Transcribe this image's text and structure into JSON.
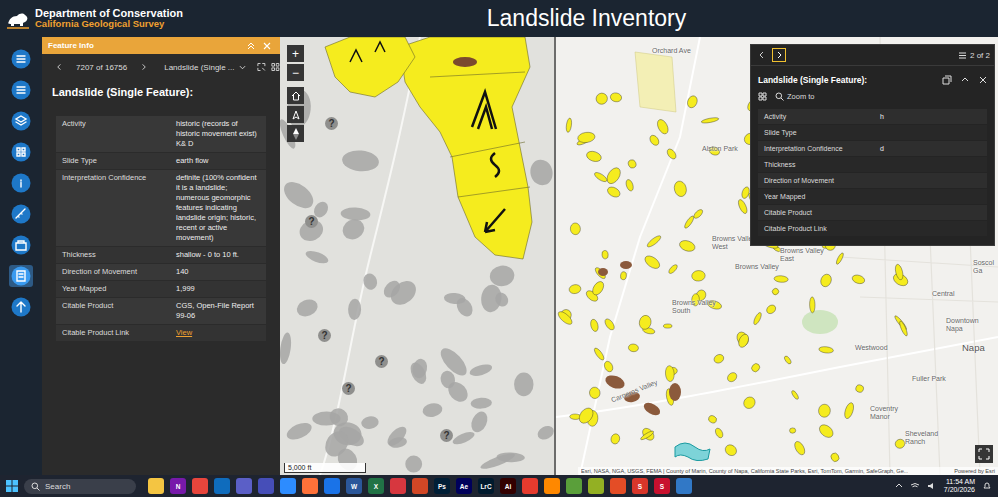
{
  "header": {
    "org": "Department of Conservation",
    "suborg": "California Geological Survey",
    "title": "Landslide Inventory"
  },
  "rail": {
    "items": [
      {
        "selected": false
      },
      {
        "selected": false
      },
      {
        "selected": false
      },
      {
        "selected": false
      },
      {
        "selected": false
      },
      {
        "selected": false
      },
      {
        "selected": false
      },
      {
        "selected": true
      },
      {
        "selected": false
      }
    ]
  },
  "feature_panel": {
    "title": "Feature Info",
    "counter": "7207 of 16756",
    "layer": "Landslide (Single ...",
    "heading": "Landslide (Single Feature):",
    "rows": [
      {
        "label": "Activity",
        "value": "historic (records of historic movement exist) K& D",
        "link": false
      },
      {
        "label": "Slide Type",
        "value": "earth flow",
        "link": false
      },
      {
        "label": "Interpretation Confidence",
        "value": "definite (100% confident it is a landslide; numerous geomorphic features indicating landslide origin; historic, recent or active movement)",
        "link": false
      },
      {
        "label": "Thickness",
        "value": "shallow - 0 to 10 ft.",
        "link": false
      },
      {
        "label": "Direction of Movement",
        "value": "140",
        "link": false
      },
      {
        "label": "Year Mapped",
        "value": "1,999",
        "link": false
      },
      {
        "label": "Citable Product",
        "value": "CGS, Open-File Report 99-06",
        "link": false
      },
      {
        "label": "Citable Product Link",
        "value": "View",
        "link": true
      }
    ]
  },
  "map": {
    "zoom_in": "+",
    "zoom_out": "−",
    "unknown_mark": "?",
    "scale": "5,000 ft",
    "attribution": "Esri, NASA, NGA, USGS, FEMA | County of Marin, County of Napa, California State Parks, Esri, TomTom, Garmin, SafeGraph, Ge...",
    "powered_by": "Powered by Esri",
    "labels": [
      "Orchard Ave",
      "Alston Park",
      "Browns Valley West",
      "Browns Valley",
      "Browns Valley East",
      "Browns Valley South",
      "Soscol Ga",
      "Central",
      "Downtown Napa",
      "Napa",
      "Westwood",
      "Fuller Park",
      "Carneros Valley",
      "Coventry Manor",
      "Sheveland Ranch"
    ]
  },
  "popup": {
    "count": "2 of 2",
    "title": "Landslide (Single Feature):",
    "zoom_to": "Zoom to",
    "rows": [
      {
        "label": "Activity",
        "value": "h"
      },
      {
        "label": "Slide Type",
        "value": ""
      },
      {
        "label": "Interpretation Confidence",
        "value": "d"
      },
      {
        "label": "Thickness",
        "value": ""
      },
      {
        "label": "Direction of Movement",
        "value": ""
      },
      {
        "label": "Year Mapped",
        "value": ""
      },
      {
        "label": "Citable Product",
        "value": ""
      },
      {
        "label": "Citable Product Link",
        "value": ""
      }
    ]
  },
  "taskbar": {
    "search": "Search",
    "time": "11:54 AM",
    "date": "7/20/2026",
    "apps": [
      {
        "label": "",
        "color": "#f4c542"
      },
      {
        "label": "N",
        "color": "#7719aa"
      },
      {
        "label": "",
        "color": "#e8453c"
      },
      {
        "label": "",
        "color": "#0f6cbd"
      },
      {
        "label": "",
        "color": "#5b5fc7"
      },
      {
        "label": "",
        "color": "#464eb8"
      },
      {
        "label": "",
        "color": "#2d8cff"
      },
      {
        "label": "",
        "color": "#ff7139"
      },
      {
        "label": "",
        "color": "#1a73e8"
      },
      {
        "label": "W",
        "color": "#2b579a"
      },
      {
        "label": "X",
        "color": "#217346"
      },
      {
        "label": "",
        "color": "#d7373f"
      },
      {
        "label": "",
        "color": "#d24726"
      },
      {
        "label": "Ps",
        "color": "#001e36"
      },
      {
        "label": "Ae",
        "color": "#00005b"
      },
      {
        "label": "LrC",
        "color": "#001a2e"
      },
      {
        "label": "Ai",
        "color": "#330000"
      },
      {
        "label": "",
        "color": "#e63b2e"
      },
      {
        "label": "",
        "color": "#ff8800"
      },
      {
        "label": "",
        "color": "#5a9f3a"
      },
      {
        "label": "",
        "color": "#93b023"
      },
      {
        "label": "",
        "color": "#e44d26"
      },
      {
        "label": "S",
        "color": "#d8362a"
      },
      {
        "label": "S",
        "color": "#c8102e"
      },
      {
        "label": "",
        "color": "#3178c6"
      }
    ]
  }
}
